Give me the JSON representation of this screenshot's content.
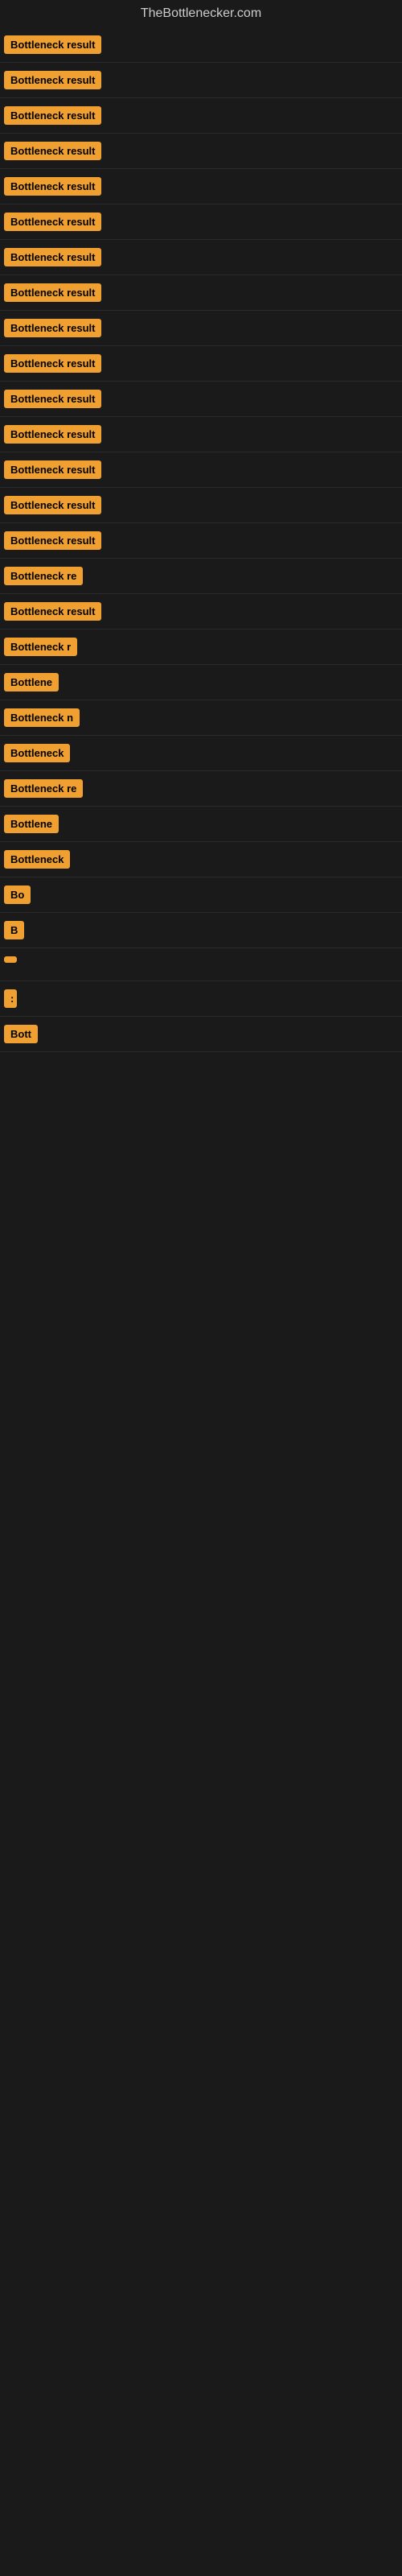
{
  "site": {
    "title": "TheBottlenecker.com"
  },
  "items": [
    {
      "id": 1,
      "label": "Bottleneck result",
      "truncation": "none"
    },
    {
      "id": 2,
      "label": "Bottleneck result",
      "truncation": "none"
    },
    {
      "id": 3,
      "label": "Bottleneck result",
      "truncation": "none"
    },
    {
      "id": 4,
      "label": "Bottleneck result",
      "truncation": "none"
    },
    {
      "id": 5,
      "label": "Bottleneck result",
      "truncation": "none"
    },
    {
      "id": 6,
      "label": "Bottleneck result",
      "truncation": "none"
    },
    {
      "id": 7,
      "label": "Bottleneck result",
      "truncation": "none"
    },
    {
      "id": 8,
      "label": "Bottleneck result",
      "truncation": "none"
    },
    {
      "id": 9,
      "label": "Bottleneck result",
      "truncation": "none"
    },
    {
      "id": 10,
      "label": "Bottleneck result",
      "truncation": "none"
    },
    {
      "id": 11,
      "label": "Bottleneck result",
      "truncation": "none"
    },
    {
      "id": 12,
      "label": "Bottleneck result",
      "truncation": "none"
    },
    {
      "id": 13,
      "label": "Bottleneck result",
      "truncation": "none"
    },
    {
      "id": 14,
      "label": "Bottleneck result",
      "truncation": "none"
    },
    {
      "id": 15,
      "label": "Bottleneck result",
      "truncation": "none"
    },
    {
      "id": 16,
      "label": "Bottleneck re",
      "truncation": "truncated-1"
    },
    {
      "id": 17,
      "label": "Bottleneck result",
      "truncation": "none"
    },
    {
      "id": 18,
      "label": "Bottleneck r",
      "truncation": "truncated-1"
    },
    {
      "id": 19,
      "label": "Bottlene",
      "truncation": "truncated-2"
    },
    {
      "id": 20,
      "label": "Bottleneck n",
      "truncation": "truncated-1"
    },
    {
      "id": 21,
      "label": "Bottleneck",
      "truncation": "truncated-2"
    },
    {
      "id": 22,
      "label": "Bottleneck re",
      "truncation": "truncated-1"
    },
    {
      "id": 23,
      "label": "Bottlene",
      "truncation": "truncated-2"
    },
    {
      "id": 24,
      "label": "Bottleneck",
      "truncation": "truncated-2"
    },
    {
      "id": 25,
      "label": "Bo",
      "truncation": "truncated-4"
    },
    {
      "id": 26,
      "label": "B",
      "truncation": "truncated-5"
    },
    {
      "id": 27,
      "label": "",
      "truncation": "truncated-8"
    },
    {
      "id": 28,
      "label": ":",
      "truncation": "truncated-8"
    },
    {
      "id": 29,
      "label": "Bott",
      "truncation": "truncated-4"
    }
  ]
}
